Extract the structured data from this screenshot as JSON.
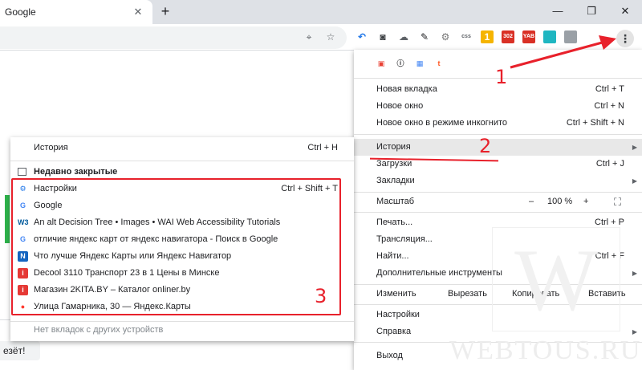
{
  "tab": {
    "title": "Google",
    "close": "✕",
    "new_tab": "+"
  },
  "window": {
    "minimize": "—",
    "restore": "❐",
    "close": "✕"
  },
  "toolbar": {
    "extensions": [
      {
        "icon": "undo-arrow-icon",
        "label": "↶",
        "color": "#1a73e8"
      },
      {
        "icon": "camera-icon",
        "label": "◙",
        "color": "#3c4043"
      },
      {
        "icon": "cloud-icon",
        "label": "☁",
        "color": "#5f6368"
      },
      {
        "icon": "pen-icon",
        "label": "✎",
        "color": "#202124"
      },
      {
        "icon": "gear-icon",
        "label": "⚙",
        "color": "#777777"
      },
      {
        "icon": "css-icon",
        "label": "css",
        "color": "#5f6368"
      },
      {
        "icon": "note-icon",
        "label": "1",
        "color": "#f5b400"
      },
      {
        "icon": "rss-icon",
        "label": "302",
        "color": "#d93025"
      },
      {
        "icon": "yab-icon",
        "label": "YAB",
        "color": "#d93025"
      },
      {
        "icon": "teal-icon",
        "label": "",
        "color": "#1fb6c1"
      },
      {
        "icon": "puzzle-icon",
        "label": "",
        "color": "#9aa0a6"
      }
    ],
    "menu_dots": "⋮"
  },
  "page": {
    "fragment": "езёт!"
  },
  "menu": {
    "top_icons": [
      {
        "icon": "image-ext-icon",
        "label": "▣",
        "color": "#e94235"
      },
      {
        "icon": "info-ext-icon",
        "label": "ⓘ",
        "color": "#202124"
      },
      {
        "icon": "grid-ext-icon",
        "label": "▦",
        "color": "#4285f4"
      },
      {
        "icon": "t-ext-icon",
        "label": "t",
        "color": "#ff5722"
      }
    ],
    "new_tab": {
      "label": "Новая вкладка",
      "shortcut": "Ctrl + T"
    },
    "new_window": {
      "label": "Новое окно",
      "shortcut": "Ctrl + N"
    },
    "incognito": {
      "label": "Новое окно в режиме инкогнито",
      "shortcut": "Ctrl + Shift + N"
    },
    "history": {
      "label": "История"
    },
    "downloads": {
      "label": "Загрузки",
      "shortcut": "Ctrl + J"
    },
    "bookmarks": {
      "label": "Закладки"
    },
    "zoom": {
      "label": "Масштаб",
      "minus": "–",
      "value": "100 %",
      "plus": "+",
      "fullscreen": "⛶"
    },
    "print": {
      "label": "Печать...",
      "shortcut": "Ctrl + P"
    },
    "cast": {
      "label": "Трансляция..."
    },
    "find": {
      "label": "Найти...",
      "shortcut": "Ctrl + F"
    },
    "more_tools": {
      "label": "Дополнительные инструменты"
    },
    "edit": {
      "label": "Изменить",
      "cut": "Вырезать",
      "copy": "Копировать",
      "paste": "Вставить"
    },
    "settings": {
      "label": "Настройки"
    },
    "help": {
      "label": "Справка"
    },
    "exit": {
      "label": "Выход"
    }
  },
  "history_submenu": {
    "history": {
      "label": "История",
      "shortcut": "Ctrl + H"
    },
    "recently_closed": "Недавно закрытые",
    "items": [
      {
        "label": "Настройки",
        "shortcut": "Ctrl + Shift + T",
        "icon": "⚙",
        "icon_color": "#1a73e8",
        "icon_bg": "transparent"
      },
      {
        "label": "Google",
        "shortcut": "",
        "icon": "G",
        "icon_color": "#4285f4",
        "icon_bg": "transparent"
      },
      {
        "label": "An alt Decision Tree • Images • WAI Web Accessibility Tutorials",
        "shortcut": "",
        "icon": "W3",
        "icon_color": "#005a9c",
        "icon_bg": "transparent"
      },
      {
        "label": "отличие яндекс карт от яндекс навигатора - Поиск в Google",
        "shortcut": "",
        "icon": "G",
        "icon_color": "#4285f4",
        "icon_bg": "transparent"
      },
      {
        "label": "Что лучше Яндекс Карты или Яндекс Навигатор",
        "shortcut": "",
        "icon": "N",
        "icon_color": "#ffffff",
        "icon_bg": "#1565c0"
      },
      {
        "label": "Decool 3110 Транспорт 23 в 1 Цены в Минске",
        "shortcut": "",
        "icon": "i",
        "icon_color": "#ffffff",
        "icon_bg": "#e53935"
      },
      {
        "label": "Магазин 2KITA.BY – Каталог onliner.by",
        "shortcut": "",
        "icon": "i",
        "icon_color": "#ffffff",
        "icon_bg": "#e53935"
      },
      {
        "label": "Улица Гамарника, 30 — Яндекс.Карты",
        "shortcut": "",
        "icon": "●",
        "icon_color": "#ff3b30",
        "icon_bg": "transparent"
      }
    ],
    "no_other_devices": "Нет вкладок с других устройств"
  },
  "annotations": {
    "n1": "1",
    "n2": "2",
    "n3": "3"
  },
  "watermark": {
    "letter": "W",
    "text": "WEBTOUS.RU"
  }
}
